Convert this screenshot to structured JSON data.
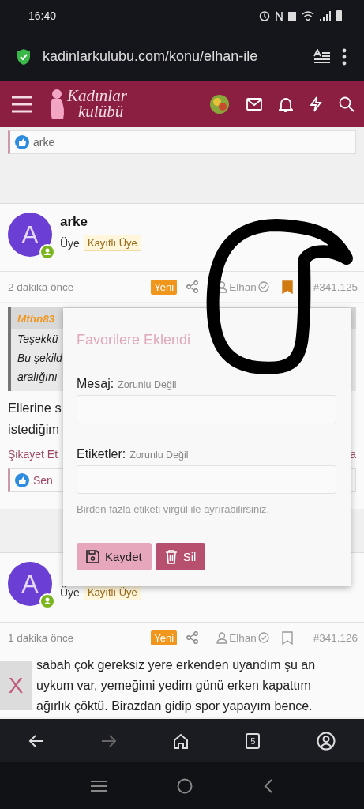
{
  "status_bar": {
    "time": "16:40"
  },
  "browser": {
    "url": "kadinlarkulubu.com/konu/elhan-ile",
    "forward_disabled": true,
    "tab_count": "5"
  },
  "site_header": {
    "logo_lines": [
      "Kadınlar",
      "kulübü"
    ]
  },
  "top_reactions": {
    "names": "arke"
  },
  "posts": [
    {
      "avatar_letter": "A",
      "author": "arke",
      "role": "Üye",
      "badge": "Kayıtlı Üye",
      "time": "2 dakika önce",
      "new_label": "Yeni",
      "user": "Elhan",
      "bookmarked": true,
      "number": "#341.125",
      "quote": {
        "author": "Mthn83",
        "lines": [
          "Teşekkü",
          "Bu şekild",
          "aralığını"
        ]
      },
      "body_lines": [
        "Ellerine s",
        "istediğim"
      ],
      "report": "Şikayet Et",
      "right_link": "a",
      "reactions": "Sen"
    },
    {
      "avatar_letter": "A",
      "role": "Üye",
      "badge": "Kayıtlı Üye",
      "time": "1 dakika önce",
      "new_label": "Yeni",
      "user": "Elhan",
      "bookmarked": false,
      "number": "#341.126",
      "body_lines": [
        "sabah çok gereksiz yere erkenden uyandım şu an",
        "uykum var, yemeğimi yedim günü erken kapattım",
        "ağırlık çöktü. Birazdan gidip spor yapayım bence."
      ]
    }
  ],
  "popup": {
    "title": "Favorilere Eklendi",
    "fields": [
      {
        "label": "Mesaj:",
        "hint": "Zorunlu Değil"
      },
      {
        "label": "Etiketler:",
        "hint": "Zorunlu Değil"
      }
    ],
    "help": "Birden fazla etiketi virgül ile ayrırabilirsiniz.",
    "buttons": [
      {
        "label": "Kaydet",
        "kind": "save"
      },
      {
        "label": "Sil",
        "kind": "delete"
      }
    ]
  },
  "close_button": "X"
}
